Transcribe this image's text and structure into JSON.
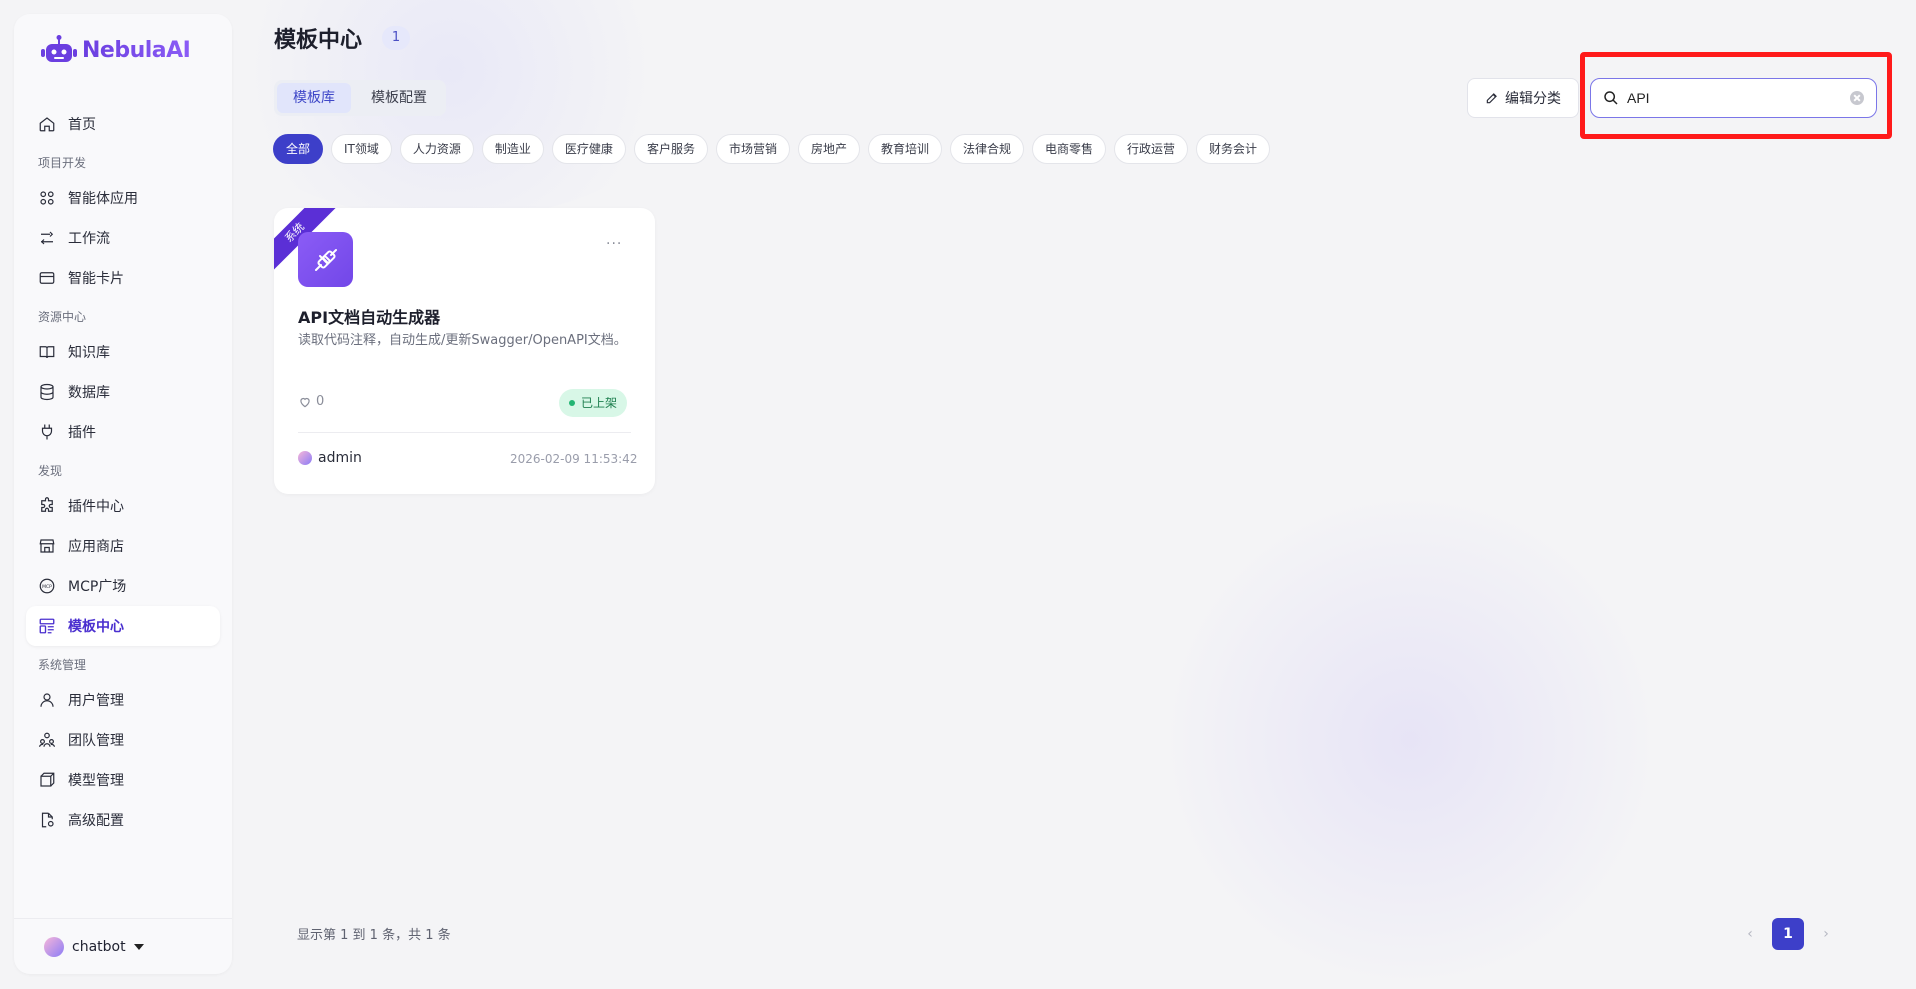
{
  "app": {
    "logo_text": "NebulaAI"
  },
  "sidebar": {
    "home": "首页",
    "sections": {
      "project": "项目开发",
      "resources": "资源中心",
      "discover": "发现",
      "system": "系统管理"
    },
    "items": {
      "agent_apps": "智能体应用",
      "workflow": "工作流",
      "smart_cards": "智能卡片",
      "knowledge": "知识库",
      "database": "数据库",
      "plugins": "插件",
      "plugin_center": "插件中心",
      "app_store": "应用商店",
      "mcp_square": "MCP广场",
      "template_center": "模板中心",
      "user_mgmt": "用户管理",
      "team_mgmt": "团队管理",
      "model_mgmt": "模型管理",
      "advanced": "高级配置"
    },
    "user": "chatbot"
  },
  "header": {
    "title": "模板中心",
    "count": "1",
    "tabs": [
      "模板库",
      "模板配置"
    ],
    "edit_category": "编辑分类",
    "search_value": "API"
  },
  "categories": [
    "全部",
    "IT领域",
    "人力资源",
    "制造业",
    "医疗健康",
    "客户服务",
    "市场营销",
    "房地产",
    "教育培训",
    "法律合规",
    "电商零售",
    "行政运营",
    "财务会计"
  ],
  "card": {
    "ribbon": "系统",
    "more": "···",
    "title": "API文档自动生成器",
    "desc": "读取代码注释，自动生成/更新Swagger/OpenAPI文档。",
    "likes": "0",
    "status": "已上架",
    "author": "admin",
    "date": "2026-02-09 11:53:42"
  },
  "pagination": {
    "summary": "显示第 1 到 1 条，共 1 条",
    "current": "1",
    "prev": "‹",
    "next": "›"
  },
  "colors": {
    "accent": "#3d3fc9",
    "brand": "#6b3fe0",
    "highlight": "#ff1a1a"
  }
}
